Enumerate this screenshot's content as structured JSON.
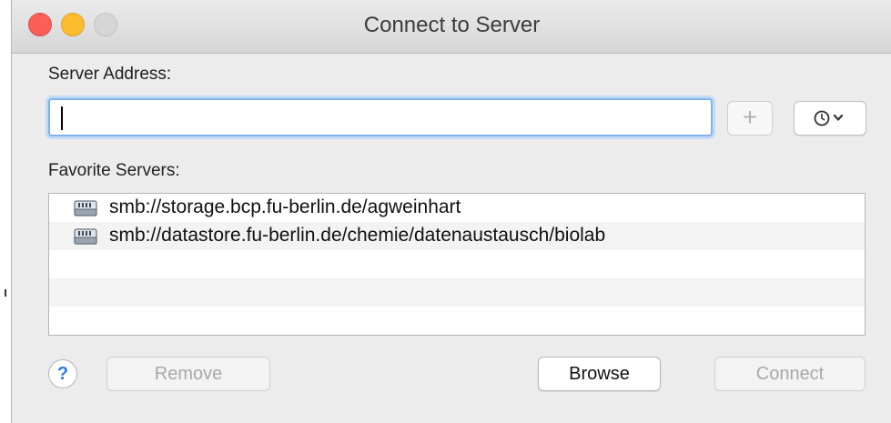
{
  "window": {
    "title": "Connect to Server"
  },
  "server_address": {
    "label": "Server Address:",
    "value": "",
    "placeholder": ""
  },
  "favorites": {
    "label": "Favorite Servers:",
    "items": [
      {
        "label": "smb://storage.bcp.fu-berlin.de/agweinhart",
        "icon": "network-drive-icon"
      },
      {
        "label": "smb://datastore.fu-berlin.de/chemie/datenaustausch/biolab",
        "icon": "network-drive-icon"
      }
    ]
  },
  "toolbar": {
    "add_label": "+",
    "recent_icon": "clock-icon"
  },
  "footer": {
    "help_label": "?",
    "remove_label": "Remove",
    "browse_label": "Browse",
    "connect_label": "Connect"
  },
  "colors": {
    "focus_ring": "#7fb2ee",
    "close": "#fc5f57",
    "minimize": "#fdbc2e",
    "help_accent": "#2f7ae5"
  }
}
